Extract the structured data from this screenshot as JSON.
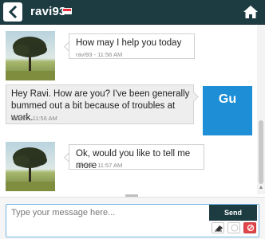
{
  "header": {
    "username": "ravi93"
  },
  "messages": [
    {
      "text": "How may I help you today",
      "meta": "ravi93 - 11:56 AM"
    },
    {
      "text": "Hey Ravi. How are you? I've been generally bummed out a bit because of troubles at work.",
      "meta": "Guest - 11:56 AM"
    },
    {
      "text": "Ok, would you like to tell me more",
      "meta": "ravi93 - 11:57 AM"
    }
  ],
  "guest_avatar_initials": "Gu",
  "composer": {
    "placeholder": "Type your message here...",
    "send_label": "Send"
  },
  "colors": {
    "header_bg": "#1d3c42",
    "guest_avatar": "#1e8fd6",
    "input_border": "#72b6e4",
    "block_button": "#e0464a"
  }
}
